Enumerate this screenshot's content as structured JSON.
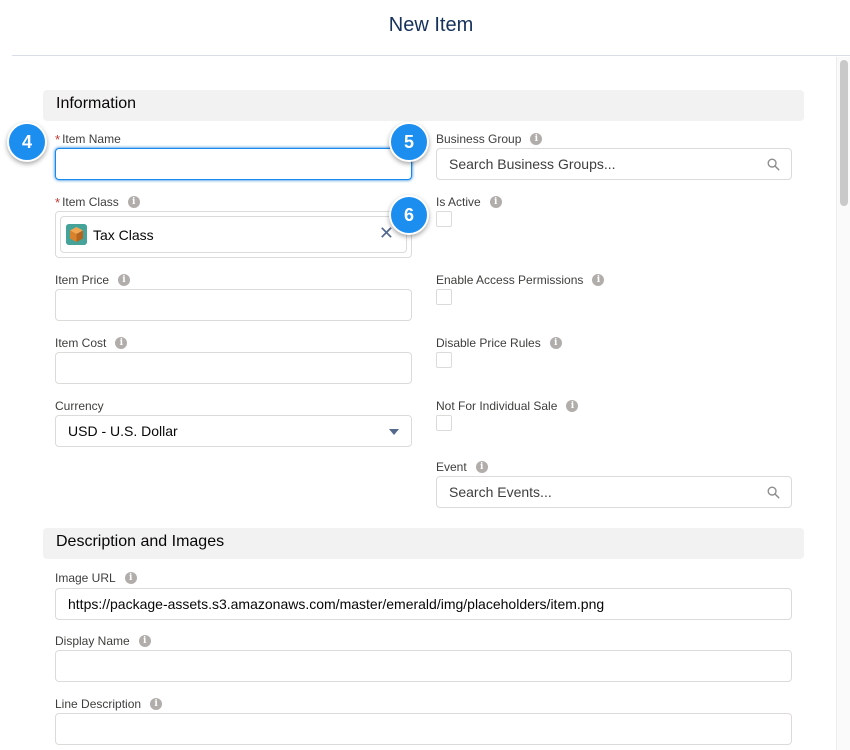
{
  "modal": {
    "title": "New Item"
  },
  "sections": {
    "information": "Information",
    "description": "Description and Images"
  },
  "fields": {
    "item_name": {
      "label": "Item Name",
      "required_mark": "*",
      "value": ""
    },
    "business_group": {
      "label": "Business Group",
      "placeholder": "Search Business Groups..."
    },
    "item_class": {
      "label": "Item Class",
      "required_mark": "*",
      "selected": "Tax Class"
    },
    "is_active": {
      "label": "Is Active",
      "checked": false
    },
    "item_price": {
      "label": "Item Price",
      "value": ""
    },
    "enable_access_permissions": {
      "label": "Enable Access Permissions",
      "checked": false
    },
    "item_cost": {
      "label": "Item Cost",
      "value": ""
    },
    "disable_price_rules": {
      "label": "Disable Price Rules",
      "checked": false
    },
    "currency": {
      "label": "Currency",
      "value": "USD - U.S. Dollar"
    },
    "not_for_individual_sale": {
      "label": "Not For Individual Sale",
      "checked": false
    },
    "event": {
      "label": "Event",
      "placeholder": "Search Events..."
    },
    "image_url": {
      "label": "Image URL",
      "value": "https://package-assets.s3.amazonaws.com/master/emerald/img/placeholders/item.png"
    },
    "display_name": {
      "label": "Display Name",
      "value": ""
    },
    "line_description": {
      "label": "Line Description",
      "value": ""
    }
  },
  "info_glyph": "i",
  "remove_glyph": "✕",
  "callouts": {
    "c4": "4",
    "c5": "5",
    "c6": "6"
  },
  "colors": {
    "callout": "#1b8ef0",
    "required": "#c23934",
    "focus": "#1589ee",
    "pill_icon": "#45a39a"
  },
  "icons": [
    "search-icon",
    "info-icon",
    "close-icon",
    "chevron-down-icon",
    "box-icon"
  ]
}
